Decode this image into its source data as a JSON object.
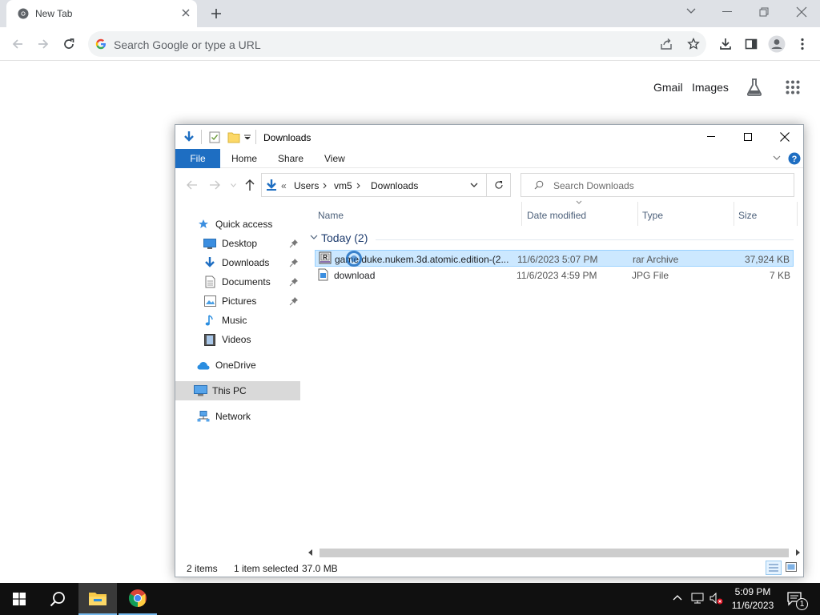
{
  "browser": {
    "tab_title": "New Tab",
    "omnibox_placeholder": "Search Google or type a URL",
    "ntp_links": {
      "gmail": "Gmail",
      "images": "Images"
    }
  },
  "explorer": {
    "title": "Downloads",
    "ribbon_tabs": {
      "file": "File",
      "home": "Home",
      "share": "Share",
      "view": "View"
    },
    "breadcrumb": {
      "prefix": "«",
      "items": [
        "Users",
        "vm5",
        "Downloads"
      ]
    },
    "search_placeholder": "Search Downloads",
    "nav": {
      "quick_access": "Quick access",
      "desktop": "Desktop",
      "downloads": "Downloads",
      "documents": "Documents",
      "pictures": "Pictures",
      "music": "Music",
      "videos": "Videos",
      "onedrive": "OneDrive",
      "this_pc": "This PC",
      "network": "Network"
    },
    "columns": {
      "name": "Name",
      "date": "Date modified",
      "type": "Type",
      "size": "Size"
    },
    "group_label": "Today (2)",
    "files": [
      {
        "name": "game.duke.nukem.3d.atomic.edition-(2...",
        "date": "11/6/2023 5:07 PM",
        "type": "rar Archive",
        "size": "37,924 KB",
        "selected": true,
        "icon": "rar-archive-icon"
      },
      {
        "name": "download",
        "date": "11/6/2023 4:59 PM",
        "type": "JPG File",
        "size": "7 KB",
        "selected": false,
        "icon": "jpg-file-icon"
      }
    ],
    "status": {
      "items": "2 items",
      "selected": "1 item selected",
      "size": "37.0 MB"
    }
  },
  "taskbar": {
    "time": "5:09 PM",
    "date": "11/6/2023",
    "notification_count": "1"
  },
  "colors": {
    "accent": "#1e6ec2",
    "selection": "#cce8ff",
    "taskbar": "#101010"
  }
}
